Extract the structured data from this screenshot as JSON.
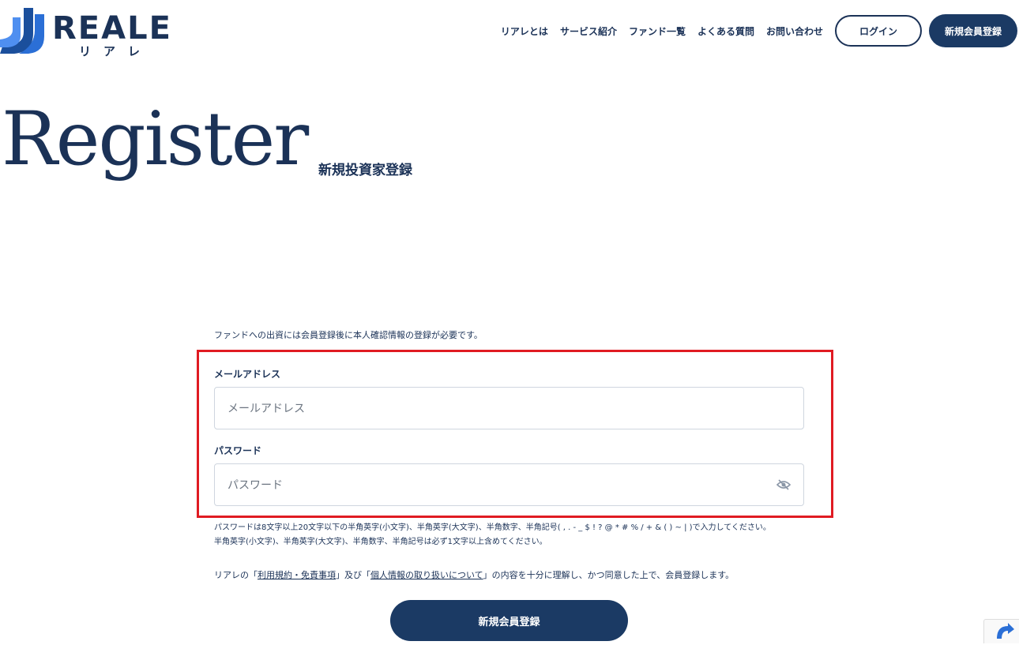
{
  "header": {
    "logo_text": "REALE",
    "logo_sub": "リアレ",
    "nav": [
      "リアレとは",
      "サービス紹介",
      "ファンド一覧",
      "よくある質問",
      "お問い合わせ"
    ],
    "login_label": "ログイン",
    "register_label": "新規会員登録"
  },
  "hero": {
    "title": "Register",
    "subtitle": "新規投資家登録"
  },
  "form": {
    "notice": "ファンドへの出資には会員登録後に本人確認情報の登録が必要です。",
    "email_label": "メールアドレス",
    "email_placeholder": "メールアドレス",
    "password_label": "パスワード",
    "password_placeholder": "パスワード",
    "hint_line1": "パスワードは8文字以上20文字以下の半角英字(小文字)、半角英字(大文字)、半角数字、半角記号( , . - _ $ ! ? @ * # % / + & ( ) ~ | )で入力してください。",
    "hint_line2": "半角英字(小文字)、半角英字(大文字)、半角数字、半角記号は必ず1文字以上含めてください。",
    "terms_prefix": "リアレの「",
    "terms_link1": "利用規約・免責事項",
    "terms_middle": "」及び「",
    "terms_link2": "個人情報の取り扱いについて",
    "terms_suffix": "」の内容を十分に理解し、かつ同意した上で、会員登録します。",
    "submit_label": "新規会員登録"
  },
  "colors": {
    "brand_navy": "#1b3a64",
    "highlight_red": "#e01b22",
    "logo_blue": "#2b6fd6"
  }
}
